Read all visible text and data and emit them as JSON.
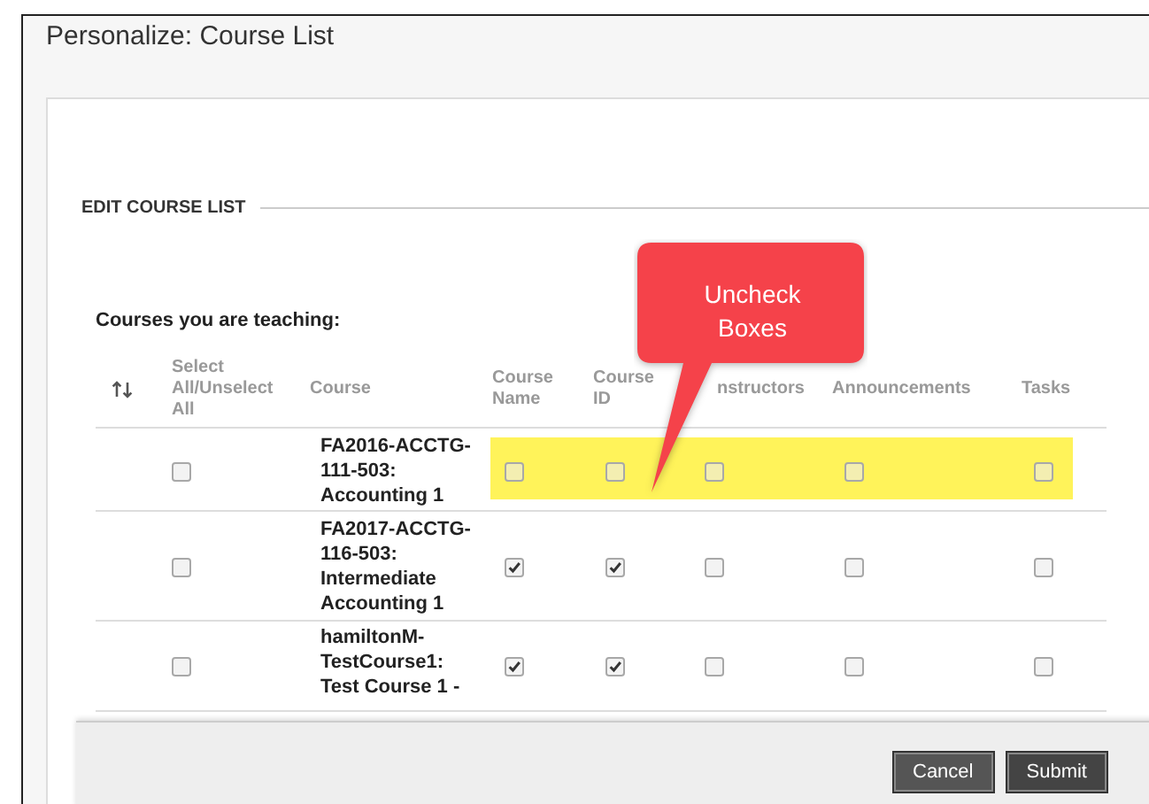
{
  "window": {
    "title": "Personalize: Course List"
  },
  "section": {
    "title": "EDIT COURSE LIST",
    "subtitle": "Courses you are teaching:"
  },
  "table": {
    "columns": [
      "Select All/Unselect All",
      "Course",
      "Course Name",
      "Course ID",
      "nstructors",
      "Announcements",
      "Tasks"
    ],
    "rows": [
      {
        "course": "FA2016-ACCTG-111-503: Accounting 1",
        "highlighted": true,
        "select": false,
        "course_name": false,
        "course_id": false,
        "instructors": false,
        "announcements": false,
        "tasks": false
      },
      {
        "course": "FA2017-ACCTG-116-503: Intermediate Accounting 1",
        "highlighted": false,
        "select": false,
        "course_name": true,
        "course_id": true,
        "instructors": false,
        "announcements": false,
        "tasks": false
      },
      {
        "course": "hamiltonM-TestCourse1: Test Course 1 -",
        "highlighted": false,
        "select": false,
        "course_name": true,
        "course_id": true,
        "instructors": false,
        "announcements": false,
        "tasks": false
      }
    ]
  },
  "callout": {
    "text": "Uncheck Boxes"
  },
  "buttons": [
    "Cancel",
    "Submit"
  ]
}
